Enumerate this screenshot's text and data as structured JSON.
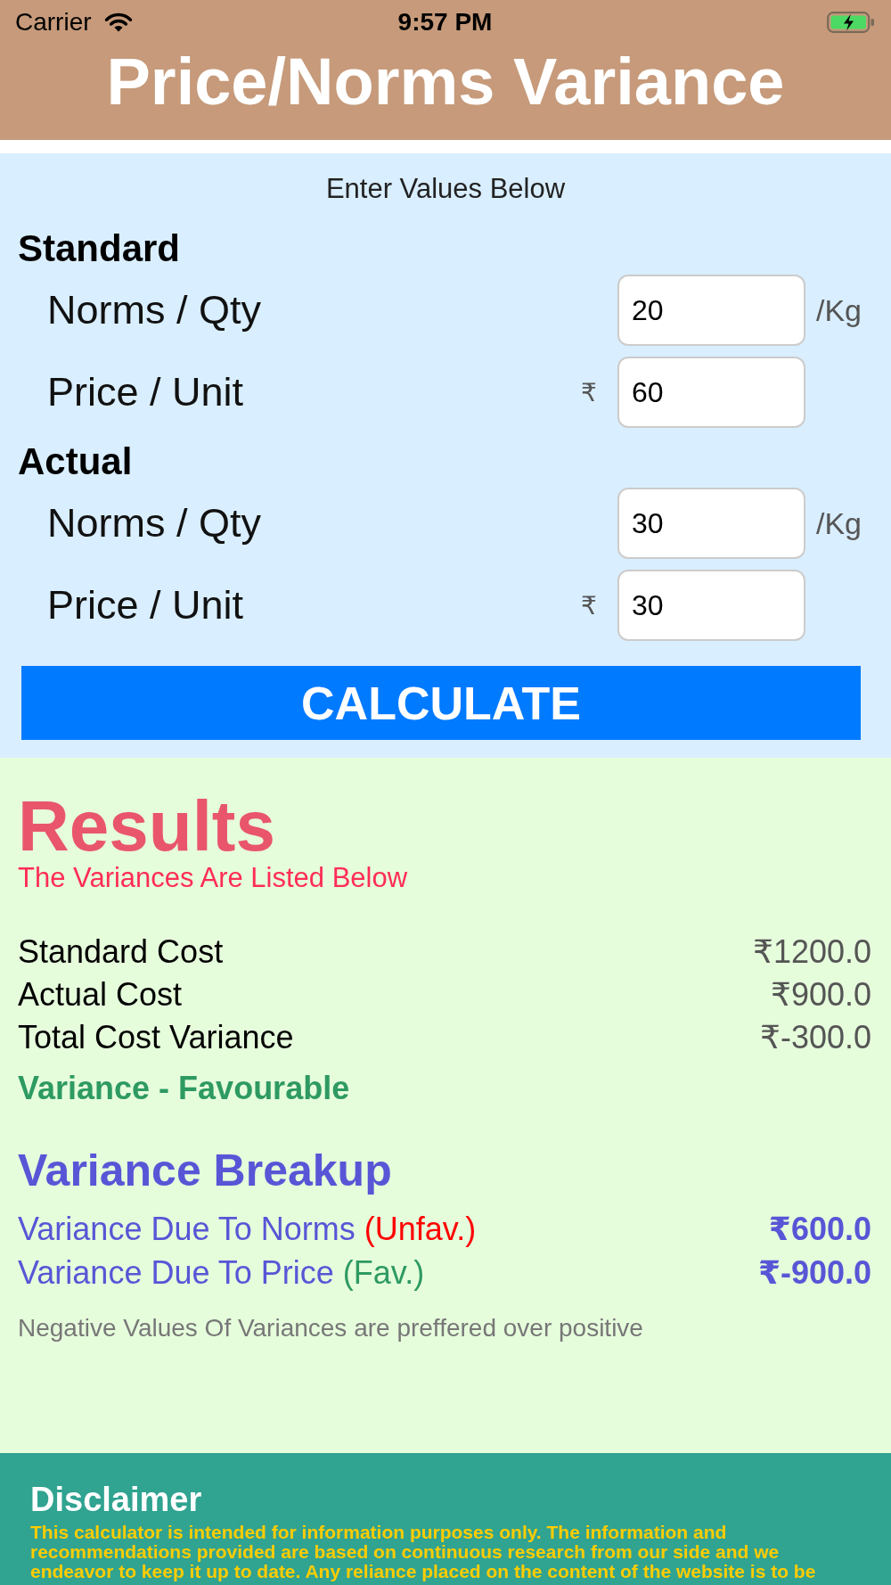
{
  "status_bar": {
    "carrier": "Carrier",
    "time": "9:57 PM"
  },
  "header": {
    "title": "Price/Norms Variance"
  },
  "inputs": {
    "instruction": "Enter Values Below",
    "groups": [
      {
        "title": "Standard",
        "fields": [
          {
            "label": "Norms / Qty",
            "value": "20",
            "kind": "suffix",
            "unit": "/Kg"
          },
          {
            "label": "Price / Unit",
            "value": "60",
            "kind": "prefix",
            "unit": "₹"
          }
        ]
      },
      {
        "title": "Actual",
        "fields": [
          {
            "label": "Norms / Qty",
            "value": "30",
            "kind": "suffix",
            "unit": "/Kg"
          },
          {
            "label": "Price / Unit",
            "value": "30",
            "kind": "prefix",
            "unit": "₹"
          }
        ]
      }
    ],
    "button": "CALCULATE"
  },
  "results": {
    "title": "Results",
    "subtitle": "The Variances Are Listed Below",
    "rows": [
      {
        "label": "Standard Cost",
        "value": "₹1200.0"
      },
      {
        "label": "Actual Cost",
        "value": "₹900.0"
      },
      {
        "label": "Total Cost Variance",
        "value": "₹-300.0"
      }
    ],
    "verdict": {
      "text": "Variance - Favourable",
      "favourable": true
    }
  },
  "breakup": {
    "title": "Variance Breakup",
    "rows": [
      {
        "label": "Variance Due To Norms",
        "tag": "(Unfav.)",
        "favourable": false,
        "value": "₹600.0"
      },
      {
        "label": "Variance Due To Price",
        "tag": "(Fav.)",
        "favourable": true,
        "value": "₹-900.0"
      }
    ],
    "note": "Negative Values Of Variances are preffered over positive"
  },
  "disclaimer": {
    "title": "Disclaimer",
    "text": "This calculator is intended for information purposes only. The information and recommendations provided are based on continuous research from our side and we endeavor to keep it up to date. Any reliance placed on the content of the website is to be"
  }
}
